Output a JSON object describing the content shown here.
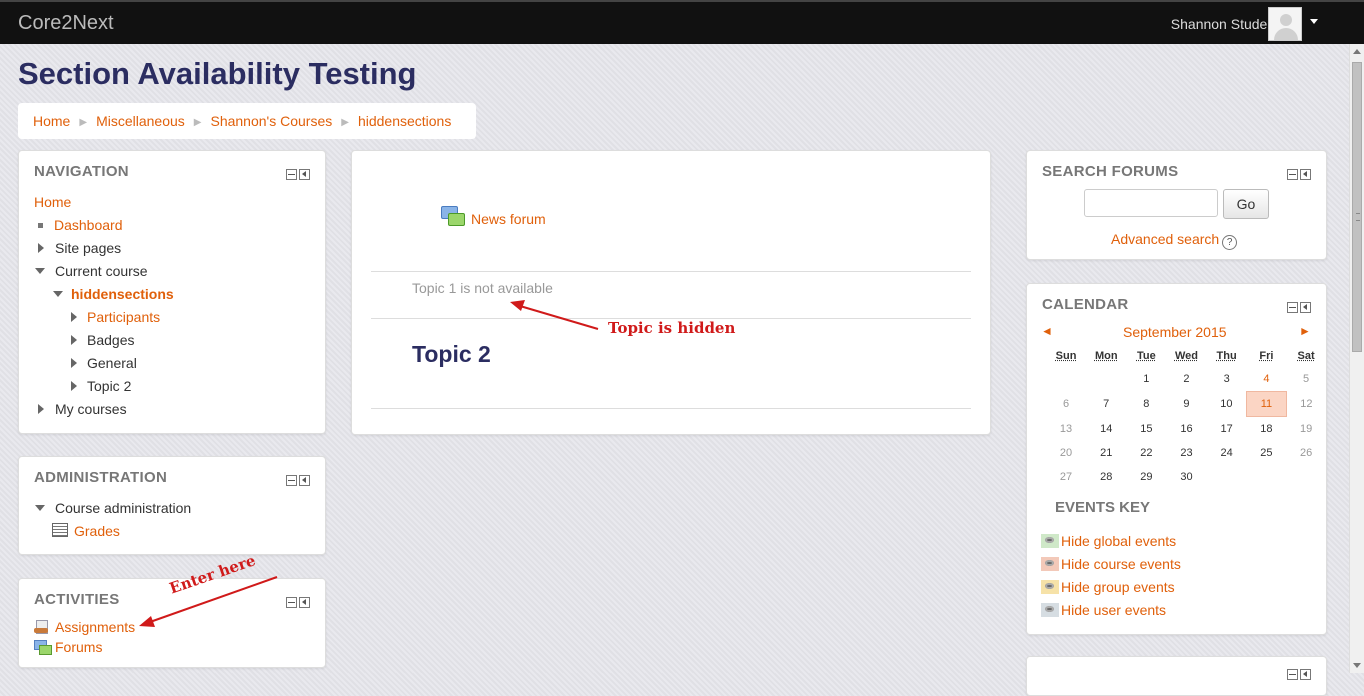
{
  "header": {
    "brand": "Core2Next",
    "user_name": "Shannon Student"
  },
  "page": {
    "title": "Section Availability Testing"
  },
  "breadcrumb": [
    "Home",
    "Miscellaneous",
    "Shannon's Courses",
    "hiddensections"
  ],
  "navigation": {
    "title": "NAVIGATION",
    "home": "Home",
    "dashboard": "Dashboard",
    "site_pages": "Site pages",
    "current_course": "Current course",
    "course": "hiddensections",
    "participants": "Participants",
    "badges": "Badges",
    "general": "General",
    "topic2": "Topic 2",
    "my_courses": "My courses"
  },
  "administration": {
    "title": "ADMINISTRATION",
    "course_admin": "Course administration",
    "grades": "Grades"
  },
  "activities": {
    "title": "ACTIVITIES",
    "assignments": "Assignments",
    "forums": "Forums"
  },
  "main": {
    "news_forum": "News forum",
    "topic1_unavailable": "Topic 1 is not available",
    "topic2_heading": "Topic 2"
  },
  "annotations": {
    "topic_hidden": "Topic is hidden",
    "enter_here": "Enter here",
    "color": "#d01a1a"
  },
  "search_forums": {
    "title": "SEARCH FORUMS",
    "go": "Go",
    "advanced": "Advanced search",
    "help": "?"
  },
  "calendar": {
    "title": "CALENDAR",
    "month": "September 2015",
    "prev": "◄",
    "next": "►",
    "days": [
      "Sun",
      "Mon",
      "Tue",
      "Wed",
      "Thu",
      "Fri",
      "Sat"
    ],
    "weeks": [
      [
        "",
        "",
        "1",
        "2",
        "3",
        "4",
        "5"
      ],
      [
        "6",
        "7",
        "8",
        "9",
        "10",
        "11",
        "12"
      ],
      [
        "13",
        "14",
        "15",
        "16",
        "17",
        "18",
        "19"
      ],
      [
        "20",
        "21",
        "22",
        "23",
        "24",
        "25",
        "26"
      ],
      [
        "27",
        "28",
        "29",
        "30",
        "",
        "",
        ""
      ]
    ],
    "today": "11",
    "event_days": [
      "4"
    ]
  },
  "events_key": {
    "title": "EVENTS KEY",
    "items": [
      {
        "label": "Hide global events",
        "color": "#cfe8c8"
      },
      {
        "label": "Hide course events",
        "color": "#f3c9b9"
      },
      {
        "label": "Hide group events",
        "color": "#f6e2a8"
      },
      {
        "label": "Hide user events",
        "color": "#d6dde2"
      }
    ]
  },
  "colors": {
    "accent": "#e0600b",
    "title": "#2b2d61",
    "topbar": "#111111"
  }
}
